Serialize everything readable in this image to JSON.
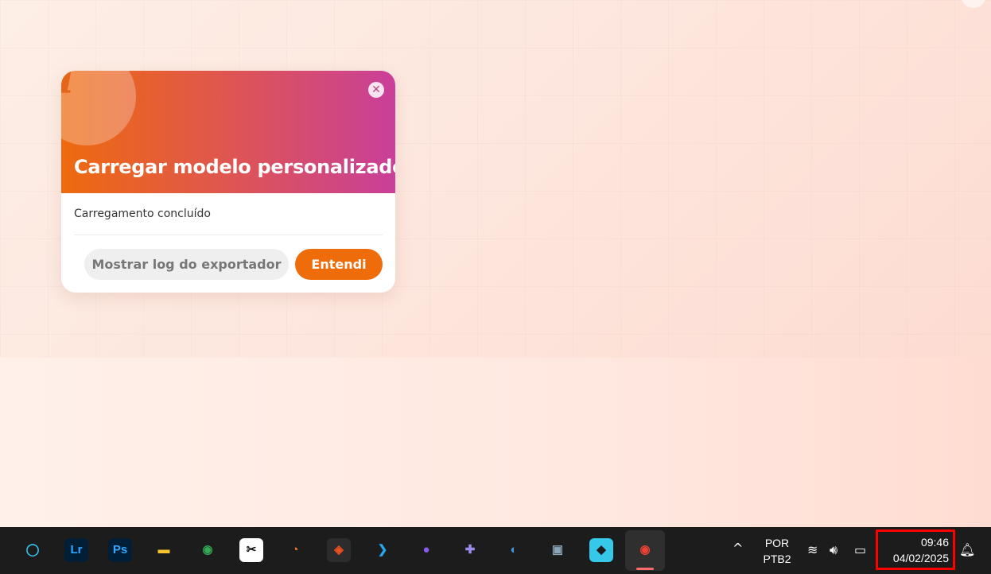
{
  "dialog": {
    "info_glyph": "i",
    "close_glyph": "✕",
    "title": "Carregar modelo personalizado",
    "message": "Carregamento concluído",
    "secondary_button": "Mostrar log do exportador",
    "primary_button": "Entendi"
  },
  "taskbar": {
    "apps": [
      {
        "name": "alexa",
        "glyph": "◯",
        "color": "#2fc4f2"
      },
      {
        "name": "lightroom",
        "glyph": "Lr",
        "color": "#31a8ff"
      },
      {
        "name": "photoshop",
        "glyph": "Ps",
        "color": "#31a8ff"
      },
      {
        "name": "file-explorer",
        "glyph": "▬",
        "color": "#f7c42d"
      },
      {
        "name": "chrome",
        "glyph": "◉",
        "color": "#34a853"
      },
      {
        "name": "capcut",
        "glyph": "✂",
        "color": "#ffffff"
      },
      {
        "name": "blender",
        "glyph": "◔",
        "color": "#f5792a"
      },
      {
        "name": "figma",
        "glyph": "◈",
        "color": "#f24e1e"
      },
      {
        "name": "vscode",
        "glyph": "❯",
        "color": "#23a9f2"
      },
      {
        "name": "github",
        "glyph": "●",
        "color": "#8a5cf6"
      },
      {
        "name": "game-controller",
        "glyph": "✚",
        "color": "#9b8cf2"
      },
      {
        "name": "vr-app",
        "glyph": "◐",
        "color": "#3b9ad9"
      },
      {
        "name": "emulator",
        "glyph": "▣",
        "color": "#8aa4b8"
      },
      {
        "name": "3d-app",
        "glyph": "◆",
        "color": "#35c8e8"
      },
      {
        "name": "chrome-active",
        "glyph": "◉",
        "color": "#ea4335"
      }
    ],
    "tray": {
      "chevron": "^",
      "lang_top": "POR",
      "lang_bottom": "PTB2",
      "time": "09:46",
      "date": "04/02/2025"
    }
  }
}
